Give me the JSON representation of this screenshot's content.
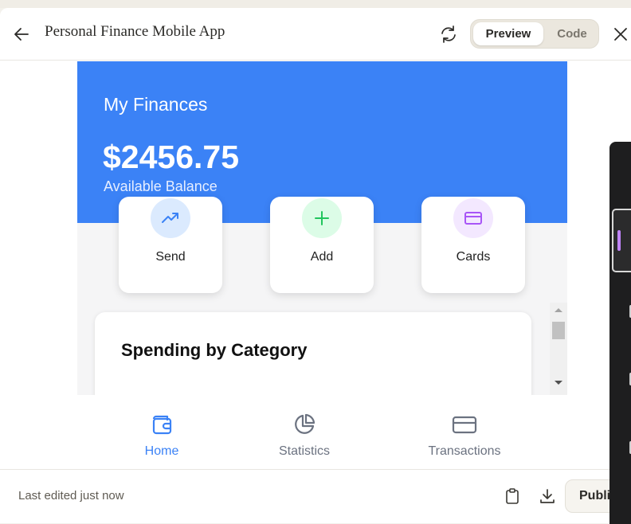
{
  "header": {
    "title": "Personal Finance Mobile App",
    "toggle": {
      "preview_label": "Preview",
      "code_label": "Code",
      "active": "Preview"
    },
    "icons": {
      "back": "arrow-left-icon",
      "refresh": "refresh-icon",
      "close": "close-icon"
    }
  },
  "app": {
    "hero": {
      "title": "My Finances",
      "balance": "$2456.75",
      "balance_caption": "Available Balance",
      "background_color": "#3b82f6"
    },
    "actions": [
      {
        "label": "Send",
        "icon": "trending-up-icon",
        "color": "#3b82f6",
        "bg": "#dbeafe"
      },
      {
        "label": "Add",
        "icon": "plus-icon",
        "color": "#22c55e",
        "bg": "#dcfce7"
      },
      {
        "label": "Cards",
        "icon": "credit-card-icon",
        "color": "#a855f7",
        "bg": "#f3e8ff"
      }
    ],
    "spending": {
      "title": "Spending by Category"
    },
    "nav": [
      {
        "label": "Home",
        "icon": "wallet-icon",
        "active": true
      },
      {
        "label": "Statistics",
        "icon": "pie-chart-icon",
        "active": false
      },
      {
        "label": "Transactions",
        "icon": "credit-card-icon",
        "active": false
      }
    ],
    "colors": {
      "nav_active": "#3b82f6",
      "nav_inactive": "#6b7280"
    }
  },
  "footer": {
    "status": "Last edited just now",
    "publish_label": "Publish",
    "icons": {
      "copy": "clipboard-icon",
      "download": "download-icon"
    }
  }
}
